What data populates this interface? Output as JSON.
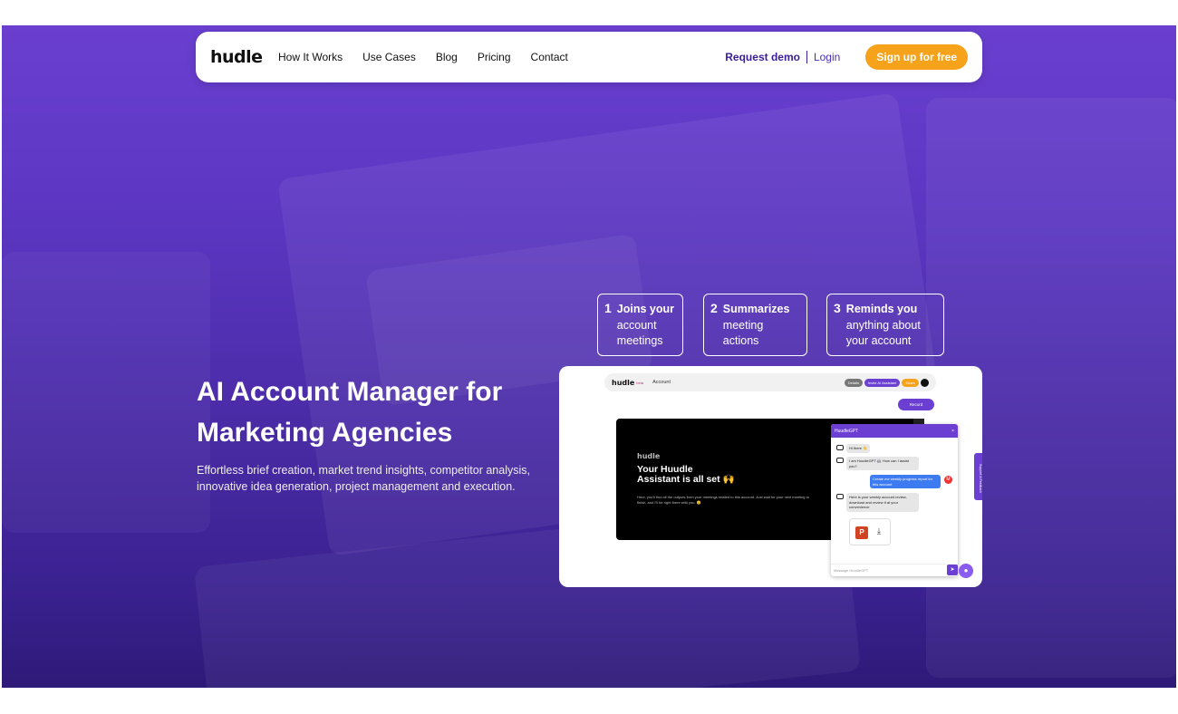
{
  "nav": {
    "logo": "hudle",
    "links": [
      "How It Works",
      "Use Cases",
      "Blog",
      "Pricing",
      "Contact"
    ],
    "request_demo": "Request demo",
    "login": "Login",
    "signup": "Sign up for free"
  },
  "hero": {
    "headline_line1": "AI Account Manager for",
    "headline_line2": "Marketing Agencies",
    "subtext": "Effortless brief creation, market trend insights, competitor analysis, innovative idea generation, project management and execution."
  },
  "steps": [
    {
      "num": "1",
      "bold": "Joins your",
      "rest1": "account",
      "rest2": "meetings"
    },
    {
      "num": "2",
      "bold": "Summarizes",
      "rest1": "meeting",
      "rest2": "actions"
    },
    {
      "num": "3",
      "bold": "Reminds you",
      "rest1": "anything about",
      "rest2": "your account"
    }
  ],
  "preview": {
    "logo": "hudle",
    "beta": "beta",
    "account": "Account",
    "btn_details": "Details",
    "btn_invite": "Invite AI Assistant",
    "btn_share": "Share",
    "record": "Record",
    "small_logo": "hudle",
    "title_line1": "Your Huudle",
    "title_line2": "Assistant is all set 🙌",
    "body": "Here, you'll find all the outputs from your meetings related to this account. Just wait for your next meeting to finish, and I'll be right there with you. 😊",
    "chat": {
      "header": "HuudleGPT",
      "close": "×",
      "msg1": "Hi there 👋",
      "msg2": "I am HuudleGPT 🤖 How can I assist you?",
      "msg3": "Create me weekly progress report for this account",
      "msg4": "Here is your weekly account review, download and review it at your convenience",
      "user_initial": "M",
      "input_placeholder": "Message HuudleGPT"
    },
    "side_tab": "Support & Feedback"
  },
  "colors": {
    "accent": "#6b3fd2",
    "signup": "#f6a21a",
    "brand_dark": "#3b1d9a"
  }
}
